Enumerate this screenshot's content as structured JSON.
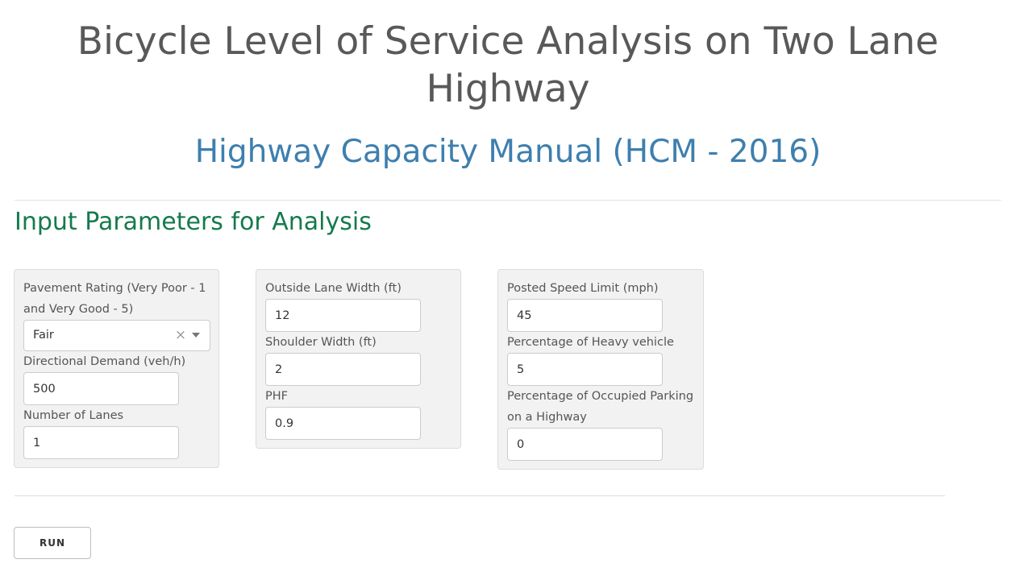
{
  "header": {
    "title_line1": "Bicycle Level of Service Analysis on Two Lane",
    "title_line2": "Highway",
    "subtitle": "Highway Capacity Manual (HCM - 2016)"
  },
  "section": {
    "title": "Input Parameters for Analysis"
  },
  "panel1": {
    "pavement_label_line1": "Pavement Rating (Very Poor - 1",
    "pavement_label_line2": "and Very Good - 5)",
    "pavement_value": "Fair",
    "pavement_clear_glyph": "×",
    "demand_label": "Directional Demand (veh/h)",
    "demand_value": "500",
    "lanes_label": "Number of Lanes",
    "lanes_value": "1"
  },
  "panel2": {
    "lane_width_label": "Outside Lane Width (ft)",
    "lane_width_value": "12",
    "shoulder_label": "Shoulder Width (ft)",
    "shoulder_value": "2",
    "phf_label": "PHF",
    "phf_value": "0.9"
  },
  "panel3": {
    "speed_label": "Posted Speed Limit (mph)",
    "speed_value": "45",
    "heavy_label": "Percentage of Heavy vehicle",
    "heavy_value": "5",
    "parking_label_line1": "Percentage of Occupied Parking",
    "parking_label_line2": "on a Highway",
    "parking_value": "0"
  },
  "actions": {
    "run_label": "RUN"
  },
  "icons": {
    "clear": "clear-icon",
    "dropdown": "chevron-down-icon"
  },
  "colors": {
    "title": "#595959",
    "subtitle": "#3e7fae",
    "section_title": "#157a4d",
    "panel_bg": "#f2f2f2"
  }
}
